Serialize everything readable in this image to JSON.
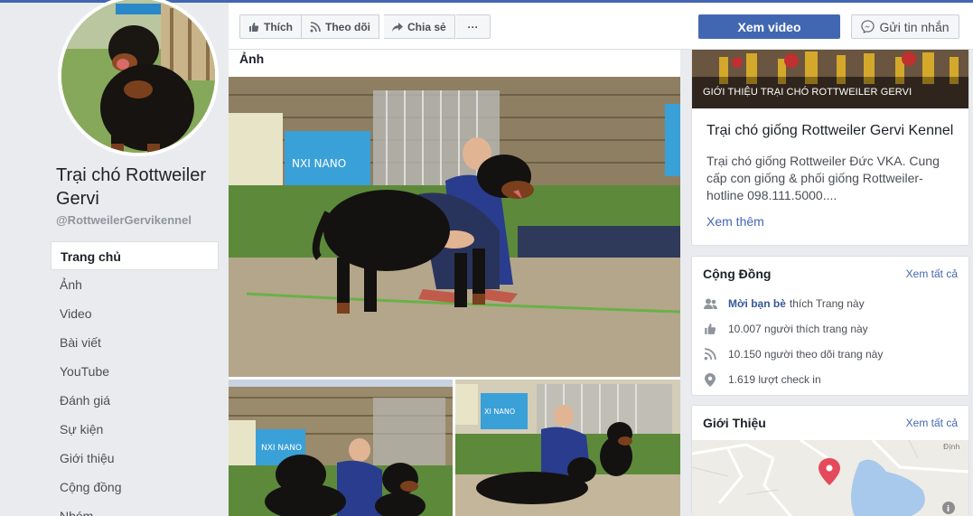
{
  "page": {
    "name": "Trại chó Rottweiler Gervi",
    "handle": "@RottweilerGervikennel"
  },
  "nav": {
    "items": [
      {
        "label": "Trang chủ",
        "active": true
      },
      {
        "label": "Ảnh"
      },
      {
        "label": "Video"
      },
      {
        "label": "Bài viết"
      },
      {
        "label": "YouTube"
      },
      {
        "label": "Đánh giá"
      },
      {
        "label": "Sự kiện"
      },
      {
        "label": "Giới thiệu"
      },
      {
        "label": "Cộng đồng"
      },
      {
        "label": "Nhóm"
      }
    ]
  },
  "actions": {
    "like": "Thích",
    "follow": "Theo dõi",
    "share": "Chia sẻ",
    "more": "···",
    "watch_video": "Xem video",
    "send_message": "Gửi tin nhắn"
  },
  "photos": {
    "title": "Ảnh"
  },
  "about": {
    "banner_text": "GIỚI THIỆU TRẠI CHÓ ROTTWEILER GERVI",
    "title": "Trại chó giống Rottweiler Gervi Kennel",
    "description": "Trại chó giống Rottweiler Đức VKA. Cung cấp con giống & phối giống Rottweiler- hotline 098.111.5000....",
    "see_more": "Xem thêm"
  },
  "community": {
    "title": "Cộng Đồng",
    "see_all": "Xem tất cả",
    "invite_link": "Mời bạn bè",
    "invite_rest": "thích Trang này",
    "likes": "10.007 người thích trang này",
    "follows": "10.150 người theo dõi trang này",
    "checkins": "1.619 lượt check in"
  },
  "intro": {
    "title": "Giới Thiệu",
    "see_all": "Xem tất cả",
    "map_label": "Định"
  },
  "colors": {
    "brand": "#4267b2",
    "link": "#365899",
    "background": "#e9ebee"
  }
}
